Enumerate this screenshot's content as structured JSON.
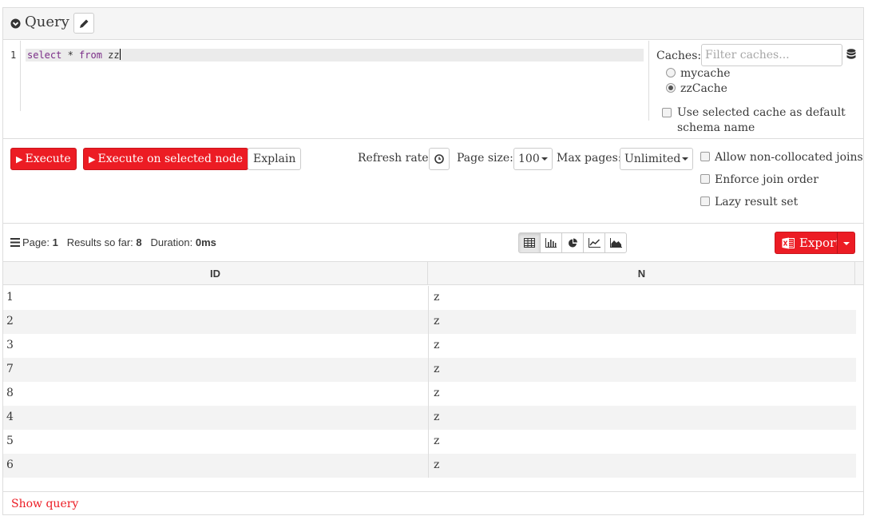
{
  "panel": {
    "title": "Query",
    "editor": {
      "line_number": "1",
      "code_tokens": [
        "select",
        " * ",
        "from",
        " zz"
      ]
    },
    "caches": {
      "label": "Caches:",
      "filter_placeholder": "Filter caches...",
      "items": [
        {
          "name": "mycache",
          "selected": false
        },
        {
          "name": "zzCache",
          "selected": true
        }
      ],
      "default_schema_label": "Use selected cache as default schema name"
    }
  },
  "actions": {
    "execute_label": "Execute",
    "execute_node_label": "Execute on selected node",
    "explain_label": "Explain",
    "refresh_rate_label": "Refresh rate:",
    "page_size_label": "Page size:",
    "page_size_value": "100",
    "max_pages_label": "Max pages:",
    "max_pages_value": "Unlimited",
    "options": {
      "non_collocated": "Allow non-collocated joins",
      "enforce_order": "Enforce join order",
      "lazy": "Lazy result set"
    }
  },
  "results": {
    "page_label": "Page:",
    "page_value": "1",
    "results_label": "Results so far:",
    "results_value": "8",
    "duration_label": "Duration:",
    "duration_value": "0ms",
    "export_label": "Export",
    "columns": [
      "ID",
      "N"
    ],
    "rows": [
      [
        "1",
        "z"
      ],
      [
        "2",
        "z"
      ],
      [
        "3",
        "z"
      ],
      [
        "7",
        "z"
      ],
      [
        "8",
        "z"
      ],
      [
        "4",
        "z"
      ],
      [
        "5",
        "z"
      ],
      [
        "6",
        "z"
      ]
    ],
    "show_query_label": "Show query"
  },
  "colors": {
    "accent": "#ec1c24",
    "keyword": "#7a2d87"
  }
}
